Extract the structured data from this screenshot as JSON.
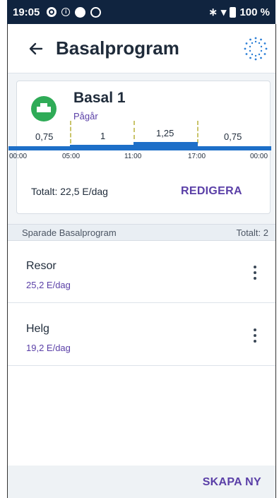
{
  "statusbar": {
    "time": "19:05",
    "wifi_icon": "wifi-icon",
    "bluetooth_icon": "bluetooth-icon",
    "battery_percent": "100 %"
  },
  "appbar": {
    "title": "Basalprogram",
    "back_icon": "arrow-left-icon",
    "pump_icon": "pump-status-icon"
  },
  "active_program": {
    "name": "Basal 1",
    "status": "Pågår",
    "total": "Totalt: 22,5 E/dag",
    "edit_label": "REDIGERA",
    "segments": [
      {
        "rate_label": "0,75",
        "rate": 0.75,
        "start": "00:00",
        "end": "05:00"
      },
      {
        "rate_label": "1",
        "rate": 1,
        "start": "05:00",
        "end": "11:00"
      },
      {
        "rate_label": "1,25",
        "rate": 1.25,
        "start": "11:00",
        "end": "17:00"
      },
      {
        "rate_label": "0,75",
        "rate": 0.75,
        "start": "17:00",
        "end": "00:00"
      }
    ],
    "time_ticks": [
      "00:00",
      "05:00",
      "11:00",
      "17:00",
      "00:00"
    ]
  },
  "saved": {
    "header": "Sparade Basalprogram",
    "count": "Totalt: 2",
    "items": [
      {
        "name": "Resor",
        "total": "25,2 E/dag"
      },
      {
        "name": "Helg",
        "total": "19,2 E/dag"
      }
    ]
  },
  "footer": {
    "create_label": "SKAPA NY"
  },
  "colors": {
    "accent": "#5a3fa7",
    "active_badge": "#2fab57",
    "bar": "#1d6fc8",
    "statusbar": "#10243f"
  }
}
